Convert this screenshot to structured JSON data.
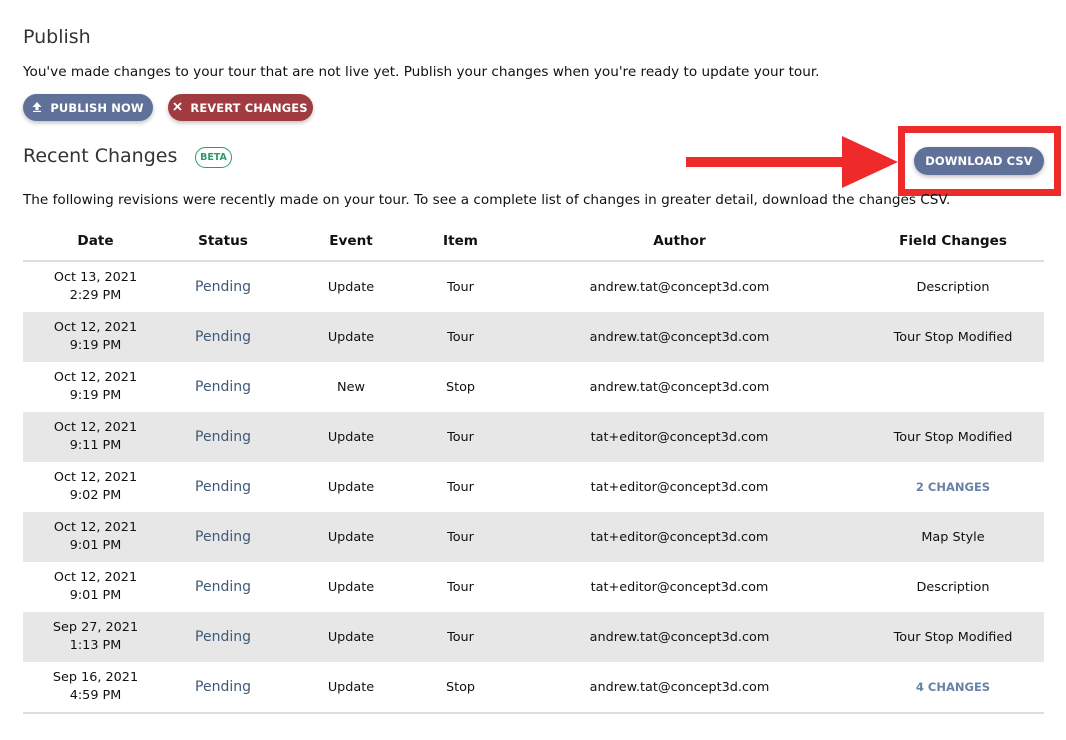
{
  "publish": {
    "title": "Publish",
    "description": "You've made changes to your tour that are not live yet. Publish your changes when you're ready to update your tour.",
    "publish_button": "PUBLISH NOW",
    "revert_button": "REVERT CHANGES"
  },
  "recent": {
    "title": "Recent Changes",
    "badge": "BETA",
    "download_button": "DOWNLOAD CSV",
    "description": "The following revisions were recently made on your tour. To see a complete list of changes in greater detail, download the changes CSV."
  },
  "table": {
    "headers": [
      "Date",
      "Status",
      "Event",
      "Item",
      "Author",
      "Field Changes"
    ],
    "rows": [
      {
        "date": "Oct 13, 2021",
        "time": "2:29 PM",
        "status": "Pending",
        "event": "Update",
        "item": "Tour",
        "author": "andrew.tat@concept3d.com",
        "field": "Description",
        "field_link": false
      },
      {
        "date": "Oct 12, 2021",
        "time": "9:19 PM",
        "status": "Pending",
        "event": "Update",
        "item": "Tour",
        "author": "andrew.tat@concept3d.com",
        "field": "Tour Stop Modified",
        "field_link": false
      },
      {
        "date": "Oct 12, 2021",
        "time": "9:19 PM",
        "status": "Pending",
        "event": "New",
        "item": "Stop",
        "author": "andrew.tat@concept3d.com",
        "field": "",
        "field_link": false
      },
      {
        "date": "Oct 12, 2021",
        "time": "9:11 PM",
        "status": "Pending",
        "event": "Update",
        "item": "Tour",
        "author": "tat+editor@concept3d.com",
        "field": "Tour Stop Modified",
        "field_link": false
      },
      {
        "date": "Oct 12, 2021",
        "time": "9:02 PM",
        "status": "Pending",
        "event": "Update",
        "item": "Tour",
        "author": "tat+editor@concept3d.com",
        "field": "2 CHANGES",
        "field_link": true
      },
      {
        "date": "Oct 12, 2021",
        "time": "9:01 PM",
        "status": "Pending",
        "event": "Update",
        "item": "Tour",
        "author": "tat+editor@concept3d.com",
        "field": "Map Style",
        "field_link": false
      },
      {
        "date": "Oct 12, 2021",
        "time": "9:01 PM",
        "status": "Pending",
        "event": "Update",
        "item": "Tour",
        "author": "tat+editor@concept3d.com",
        "field": "Description",
        "field_link": false
      },
      {
        "date": "Sep 27, 2021",
        "time": "1:13 PM",
        "status": "Pending",
        "event": "Update",
        "item": "Tour",
        "author": "andrew.tat@concept3d.com",
        "field": "Tour Stop Modified",
        "field_link": false
      },
      {
        "date": "Sep 16, 2021",
        "time": "4:59 PM",
        "status": "Pending",
        "event": "Update",
        "item": "Stop",
        "author": "andrew.tat@concept3d.com",
        "field": "4 CHANGES",
        "field_link": true
      }
    ]
  },
  "icons": {
    "publish": "upload-icon",
    "revert": "close-icon",
    "annotation": "arrow-right-icon"
  },
  "colors": {
    "primary_button": "#5f7198",
    "danger_button": "#a03c3f",
    "beta": "#2e9a6a",
    "annotation": "#ee2a2a",
    "status": "#3f5a78",
    "link": "#6a82a8"
  }
}
